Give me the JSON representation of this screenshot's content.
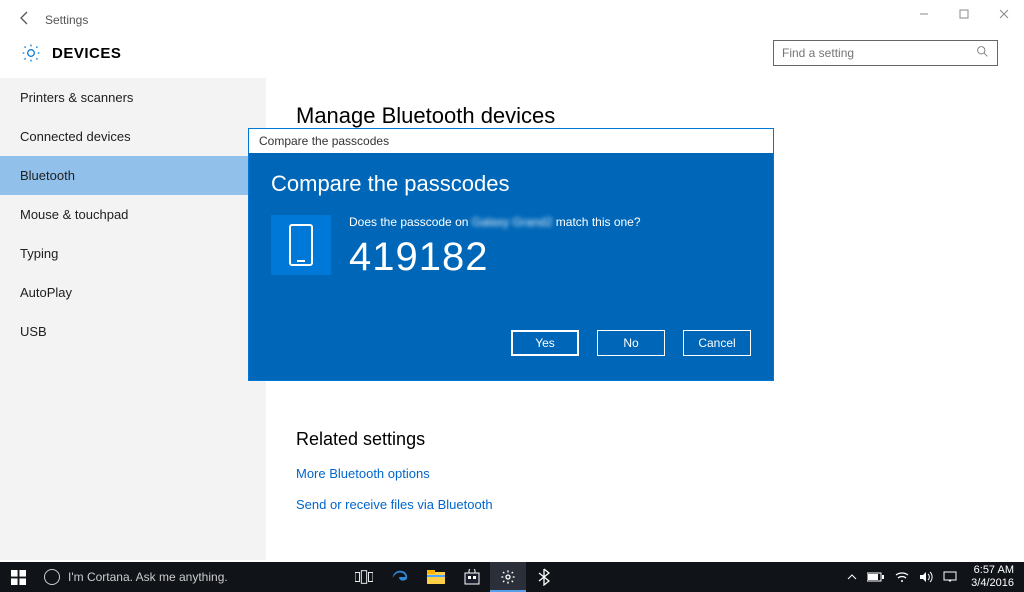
{
  "window": {
    "title": "Settings",
    "section": "DEVICES",
    "search_placeholder": "Find a setting"
  },
  "sidebar": {
    "items": [
      {
        "label": "Printers & scanners"
      },
      {
        "label": "Connected devices"
      },
      {
        "label": "Bluetooth",
        "selected": true
      },
      {
        "label": "Mouse & touchpad"
      },
      {
        "label": "Typing"
      },
      {
        "label": "AutoPlay"
      },
      {
        "label": "USB"
      }
    ]
  },
  "page": {
    "heading": "Manage Bluetooth devices",
    "related_heading": "Related settings",
    "links": [
      {
        "label": "More Bluetooth options"
      },
      {
        "label": "Send or receive files via Bluetooth"
      }
    ]
  },
  "dialog": {
    "titlebar": "Compare the passcodes",
    "heading": "Compare the passcodes",
    "question_prefix": "Does the passcode on ",
    "device_name": "Galaxy Grand2",
    "question_suffix": " match this one?",
    "passcode": "419182",
    "buttons": {
      "yes": "Yes",
      "no": "No",
      "cancel": "Cancel"
    }
  },
  "taskbar": {
    "cortana_placeholder": "I'm Cortana. Ask me anything.",
    "clock_time": "6:57 AM",
    "clock_date": "3/4/2016"
  }
}
